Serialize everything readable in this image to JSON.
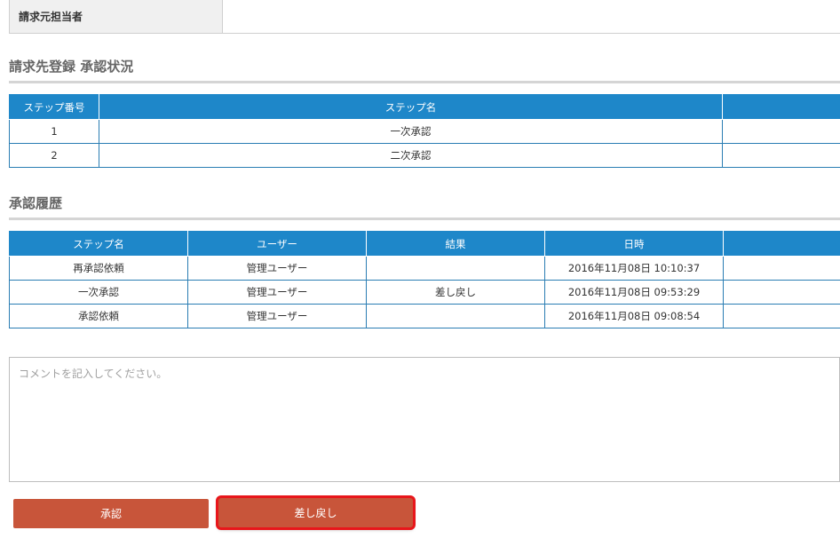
{
  "requester": {
    "label": "請求元担当者",
    "value": ""
  },
  "approval_status": {
    "title": "請求先登録 承認状況",
    "headers": [
      "ステップ番号",
      "ステップ名",
      ""
    ],
    "rows": [
      {
        "num": "1",
        "name": "一次承認",
        "extra": ""
      },
      {
        "num": "2",
        "name": "二次承認",
        "extra": ""
      }
    ]
  },
  "history": {
    "title": "承認履歴",
    "headers": [
      "ステップ名",
      "ユーザー",
      "結果",
      "日時",
      ""
    ],
    "rows": [
      {
        "step": "再承認依頼",
        "user": "管理ユーザー",
        "result": "",
        "datetime": "2016年11月08日 10:10:37",
        "extra": ""
      },
      {
        "step": "一次承認",
        "user": "管理ユーザー",
        "result": "差し戻し",
        "datetime": "2016年11月08日 09:53:29",
        "extra": ""
      },
      {
        "step": "承認依頼",
        "user": "管理ユーザー",
        "result": "",
        "datetime": "2016年11月08日 09:08:54",
        "extra": ""
      }
    ]
  },
  "comment": {
    "placeholder": "コメントを記入してください。",
    "value": ""
  },
  "buttons": {
    "approve": "承認",
    "reject": "差し戻し"
  },
  "colors": {
    "header_blue": "#1e87c9",
    "button": "#c8553a",
    "highlight": "#e8161b"
  }
}
